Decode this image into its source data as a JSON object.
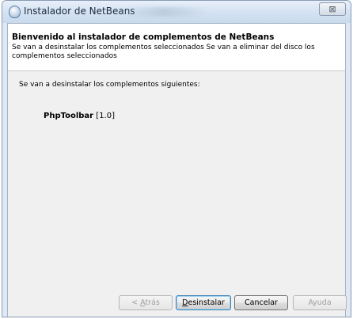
{
  "window": {
    "title": "Instalador de NetBeans",
    "close_symbol": "⊠"
  },
  "header": {
    "title": "Bienvenido al instalador de complementos de NetBeans",
    "description": "Se van a desinstalar los complementos seleccionados Se van a eliminar del disco los complementos seleccionados"
  },
  "content": {
    "label": "Se van a desinstalar los complementos siguientes:",
    "plugins": [
      {
        "name": "PhpToolbar",
        "version": "[1.0]"
      }
    ]
  },
  "buttons": {
    "back": {
      "prefix": "< ",
      "mnemonic": "A",
      "rest": "trás",
      "enabled": false
    },
    "uninstall": {
      "prefix": "",
      "mnemonic": "D",
      "rest": "esinstalar",
      "enabled": true
    },
    "cancel": {
      "label": "Cancelar",
      "enabled": true
    },
    "help": {
      "label": "Ayuda",
      "enabled": false
    }
  }
}
